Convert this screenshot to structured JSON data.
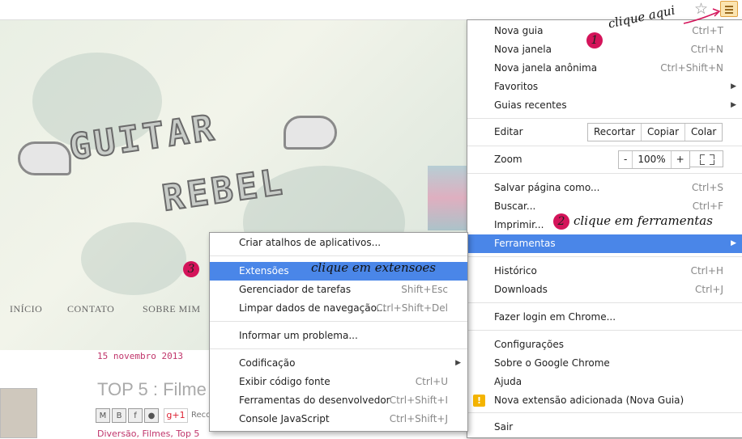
{
  "browser": {
    "star_icon": "star-icon",
    "menu_icon": "hamburger-menu-icon"
  },
  "page": {
    "nav": [
      "INÍCIO",
      "CONTATO",
      "SOBRE MIM"
    ],
    "post_date": "15 novembro 2013",
    "post_title": "TOP 5 : Filme",
    "share_text": "Reco",
    "gplus_label": "g+1",
    "tags": "Diversão, Filmes, Top 5",
    "logo_line1": "GUITAR",
    "logo_line2": "REBEL"
  },
  "chrome_menu": {
    "items": [
      {
        "label": "Nova guia",
        "shortcut": "Ctrl+T"
      },
      {
        "label": "Nova janela",
        "shortcut": "Ctrl+N"
      },
      {
        "label": "Nova janela anônima",
        "shortcut": "Ctrl+Shift+N"
      },
      {
        "label": "Favoritos",
        "submenu": true
      },
      {
        "label": "Guias recentes",
        "submenu": true
      }
    ],
    "edit": {
      "label": "Editar",
      "cut": "Recortar",
      "copy": "Copiar",
      "paste": "Colar"
    },
    "zoom": {
      "label": "Zoom",
      "minus": "-",
      "value": "100%",
      "plus": "+"
    },
    "items2": [
      {
        "label": "Salvar página como...",
        "shortcut": "Ctrl+S"
      },
      {
        "label": "Buscar...",
        "shortcut": "Ctrl+F"
      },
      {
        "label": "Imprimir...",
        "shortcut": ""
      },
      {
        "label": "Ferramentas",
        "submenu": true
      }
    ],
    "items3": [
      {
        "label": "Histórico",
        "shortcut": "Ctrl+H"
      },
      {
        "label": "Downloads",
        "shortcut": "Ctrl+J"
      }
    ],
    "login": "Fazer login em Chrome...",
    "items4": [
      {
        "label": "Configurações"
      },
      {
        "label": "Sobre o Google Chrome"
      },
      {
        "label": "Ajuda"
      },
      {
        "label": "Nova extensão adicionada (Nova Guia)"
      }
    ],
    "exit": "Sair"
  },
  "tools_menu": {
    "items": [
      {
        "label": "Criar atalhos de aplicativos...",
        "shortcut": ""
      },
      {
        "label": "Extensões",
        "shortcut": ""
      },
      {
        "label": "Gerenciador de tarefas",
        "shortcut": "Shift+Esc"
      },
      {
        "label": "Limpar dados de navegação...",
        "shortcut": "Ctrl+Shift+Del"
      },
      {
        "label": "Informar um problema...",
        "shortcut": ""
      },
      {
        "label": "Codificação",
        "shortcut": ""
      },
      {
        "label": "Exibir código fonte",
        "shortcut": "Ctrl+U"
      },
      {
        "label": "Ferramentas do desenvolvedor",
        "shortcut": "Ctrl+Shift+I"
      },
      {
        "label": "Console JavaScript",
        "shortcut": "Ctrl+Shift+J"
      }
    ]
  },
  "annotations": {
    "step1_number": "1",
    "step1_text": "clique aqui",
    "step2_number": "2",
    "step2_text": "clique em ferramentas",
    "step3_number": "3",
    "step3_text": "clique em extensoes"
  },
  "colors": {
    "highlight": "#4a86e8",
    "badge": "#d4145a",
    "warning": "#f4b400"
  }
}
